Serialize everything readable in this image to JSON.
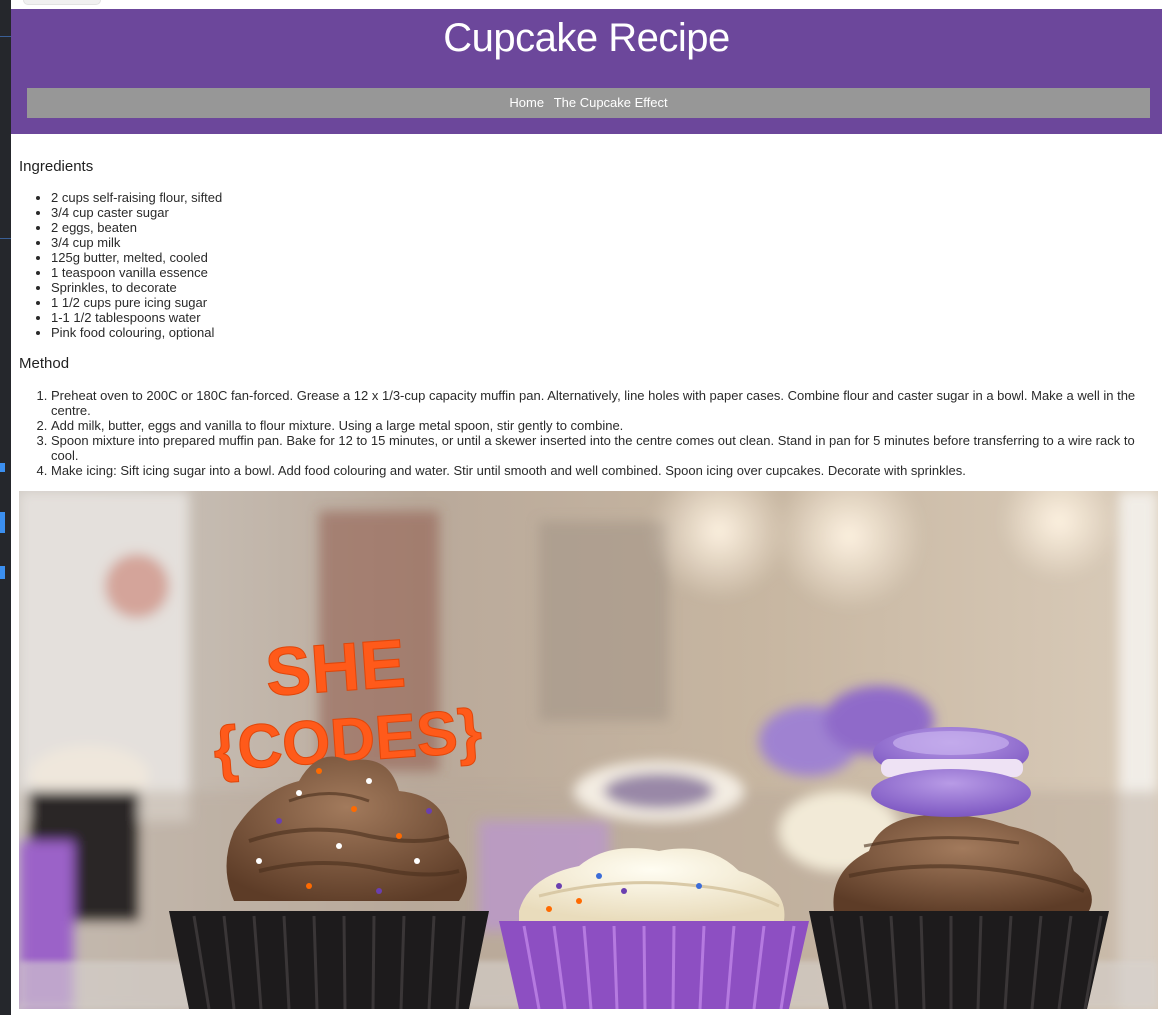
{
  "header": {
    "title": "Cupcake Recipe"
  },
  "nav": {
    "links": [
      "Home",
      "The Cupcake Effect"
    ]
  },
  "ingredients": {
    "heading": "Ingredients",
    "items": [
      "2 cups self-raising flour, sifted",
      "3/4 cup caster sugar",
      "2 eggs, beaten",
      "3/4 cup milk",
      "125g butter, melted, cooled",
      "1 teaspoon vanilla essence",
      "Sprinkles, to decorate",
      "1 1/2 cups pure icing sugar",
      "1-1 1/2 tablespoons water",
      "Pink food colouring, optional"
    ]
  },
  "method": {
    "heading": "Method",
    "steps": [
      "Preheat oven to 200C or 180C fan-forced. Grease a 12 x 1/3-cup capacity muffin pan. Alternatively, line holes with paper cases. Combine flour and caster sugar in a bowl. Make a well in the centre.",
      "Add milk, butter, eggs and vanilla to flour mixture. Using a large metal spoon, stir gently to combine.",
      "Spoon mixture into prepared muffin pan. Bake for 12 to 15 minutes, or until a skewer inserted into the centre comes out clean. Stand in pan for 5 minutes before transferring to a wire rack to cool.",
      "Make icing: Sift icing sugar into a bowl. Add food colouring and water. Stir until smooth and well combined. Spoon icing over cupcakes. Decorate with sprinkles."
    ]
  },
  "photo": {
    "topper_line1": "SHE",
    "topper_line2": "{CODES}"
  },
  "colors": {
    "header_bg": "#6c479b",
    "nav_bg": "#979797",
    "macaron": "#9b7ad6",
    "topper": "#ff5a1a",
    "liner_purple": "#8d4fc2"
  }
}
